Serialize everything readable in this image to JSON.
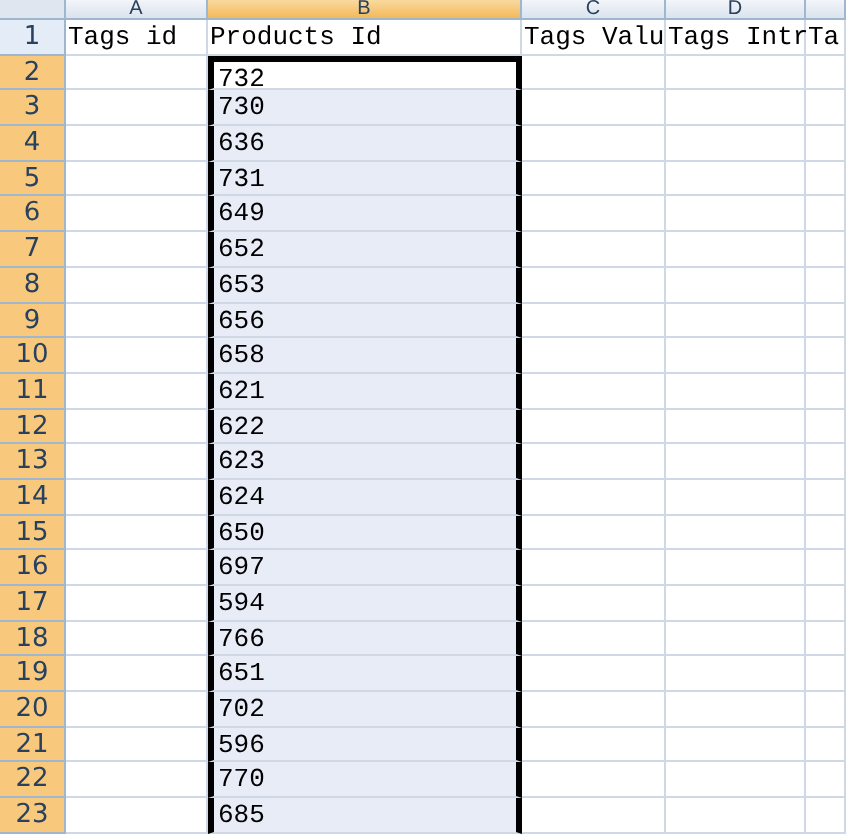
{
  "columns": [
    {
      "letter": "A",
      "selected": false
    },
    {
      "letter": "B",
      "selected": true
    },
    {
      "letter": "C",
      "selected": false
    },
    {
      "letter": "D",
      "selected": false
    }
  ],
  "header_row": {
    "number": "1",
    "selected": false,
    "cells": [
      "Tags id",
      "Products Id",
      "Tags Valu",
      "Tags Intr",
      "Ta"
    ]
  },
  "rows": [
    {
      "number": "2",
      "selected": true,
      "active": true,
      "products_id": "732"
    },
    {
      "number": "3",
      "selected": true,
      "active": false,
      "products_id": "730"
    },
    {
      "number": "4",
      "selected": true,
      "active": false,
      "products_id": "636"
    },
    {
      "number": "5",
      "selected": true,
      "active": false,
      "products_id": "731"
    },
    {
      "number": "6",
      "selected": true,
      "active": false,
      "products_id": "649"
    },
    {
      "number": "7",
      "selected": true,
      "active": false,
      "products_id": "652"
    },
    {
      "number": "8",
      "selected": true,
      "active": false,
      "products_id": "653"
    },
    {
      "number": "9",
      "selected": true,
      "active": false,
      "products_id": "656"
    },
    {
      "number": "10",
      "selected": true,
      "active": false,
      "products_id": "658"
    },
    {
      "number": "11",
      "selected": true,
      "active": false,
      "products_id": "621"
    },
    {
      "number": "12",
      "selected": true,
      "active": false,
      "products_id": "622"
    },
    {
      "number": "13",
      "selected": true,
      "active": false,
      "products_id": "623"
    },
    {
      "number": "14",
      "selected": true,
      "active": false,
      "products_id": "624"
    },
    {
      "number": "15",
      "selected": true,
      "active": false,
      "products_id": "650"
    },
    {
      "number": "16",
      "selected": true,
      "active": false,
      "products_id": "697"
    },
    {
      "number": "17",
      "selected": true,
      "active": false,
      "products_id": "594"
    },
    {
      "number": "18",
      "selected": true,
      "active": false,
      "products_id": "766"
    },
    {
      "number": "19",
      "selected": true,
      "active": false,
      "products_id": "651"
    },
    {
      "number": "20",
      "selected": true,
      "active": false,
      "products_id": "702"
    },
    {
      "number": "21",
      "selected": true,
      "active": false,
      "products_id": "596"
    },
    {
      "number": "22",
      "selected": true,
      "active": false,
      "products_id": "770"
    },
    {
      "number": "23",
      "selected": true,
      "active": false,
      "products_id": "685"
    }
  ]
}
